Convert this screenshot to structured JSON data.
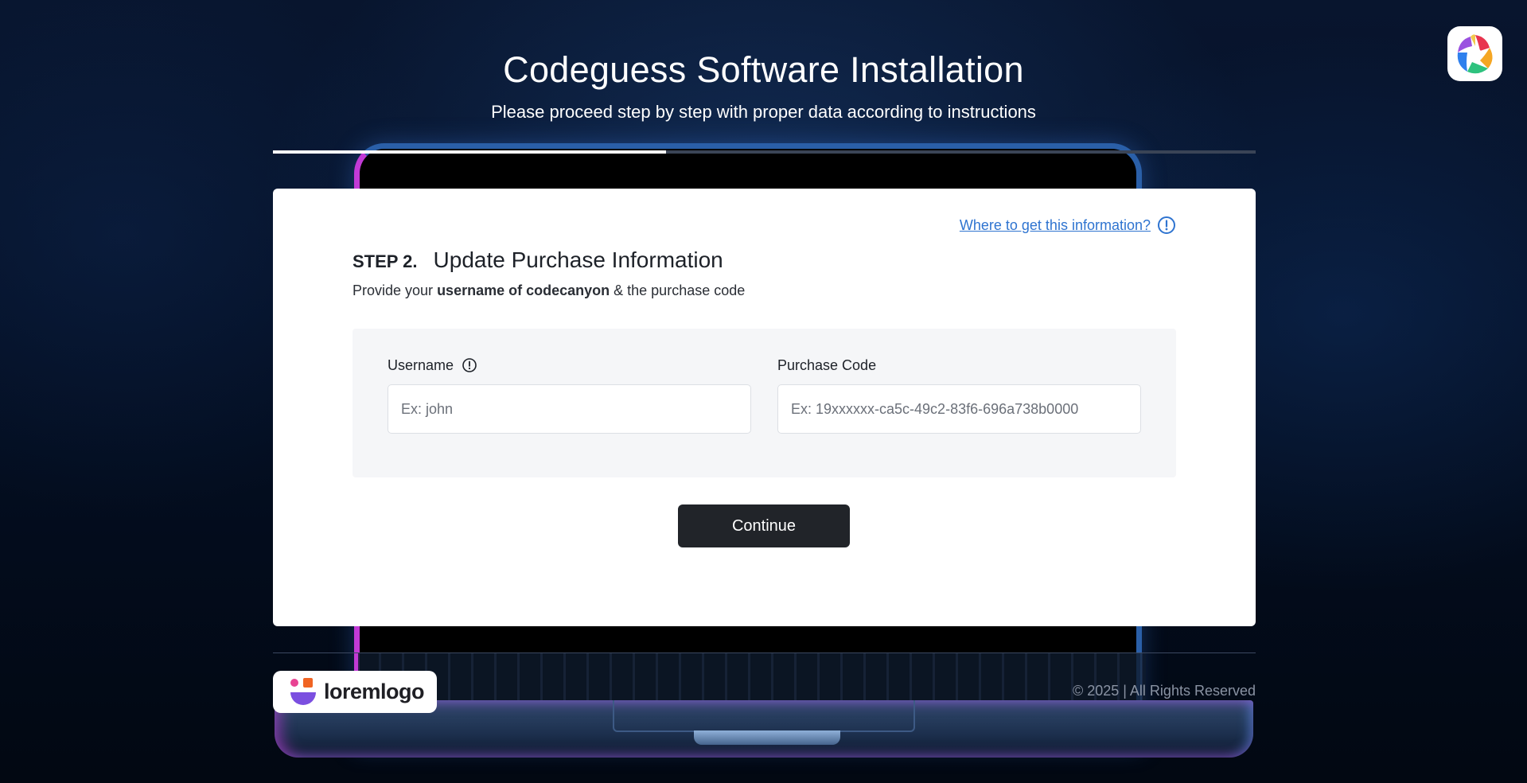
{
  "header": {
    "title": "Codeguess Software Installation",
    "subtitle": "Please proceed step by step with proper data according to instructions"
  },
  "progress": {
    "value": 0.4
  },
  "app_icon": {
    "name": "colorful-pinwheel-icon"
  },
  "card": {
    "help_link": "Where to get this information?",
    "step_number": "STEP 2.",
    "step_title": "Update Purchase Information",
    "description": {
      "prefix": "Provide your ",
      "bold": "username of codecanyon",
      "suffix": " & the purchase code"
    },
    "fields": {
      "username": {
        "label": "Username",
        "placeholder": "Ex: john",
        "value": ""
      },
      "purchase_code": {
        "label": "Purchase Code",
        "placeholder": "Ex: 19xxxxxx-ca5c-49c2-83f6-696a738b0000",
        "value": ""
      }
    },
    "continue_label": "Continue"
  },
  "footer": {
    "logo_text": "loremlogo",
    "copyright": "© 2025 | All Rights Reserved"
  },
  "colors": {
    "background": "#030a18",
    "card": "#ffffff",
    "link": "#2f74d0",
    "button": "#212429",
    "panel": "#f5f6f8"
  }
}
